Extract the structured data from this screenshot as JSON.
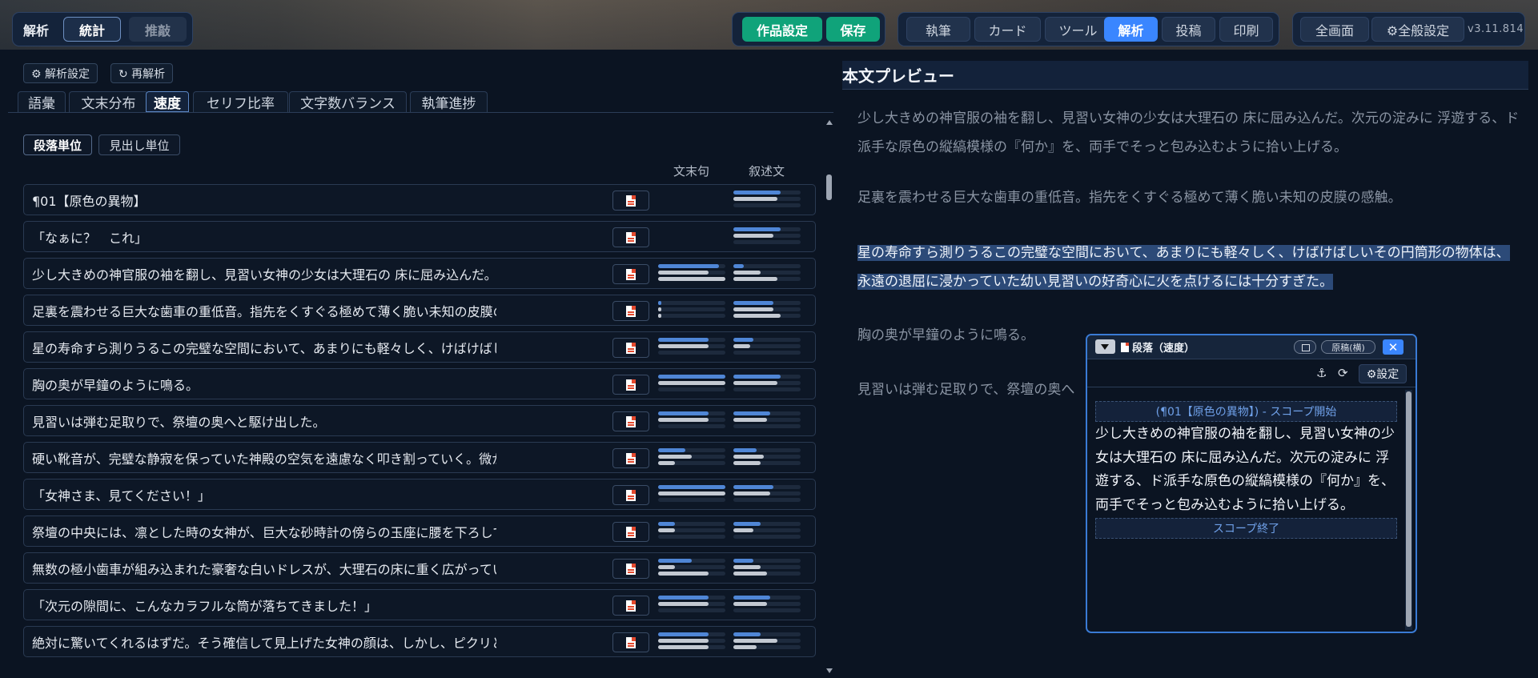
{
  "toolbar": {
    "left_group": {
      "label": "解析",
      "tab_stats": "統計",
      "tab_revise": "推敲"
    },
    "work_settings": "作品設定",
    "save": "保存",
    "mode_tabs": [
      "執筆",
      "カード",
      "ツール",
      "解析",
      "投稿",
      "印刷"
    ],
    "active_mode": "解析",
    "fullscreen": "全画面",
    "global_settings": "⚙全般設定",
    "version": "v3.11.814"
  },
  "analysis": {
    "settings_button": "⚙ 解析設定",
    "reanalyze_button": "↻ 再解析",
    "tabs": [
      "語彙",
      "文末分布",
      "速度",
      "セリフ比率",
      "文字数バランス",
      "執筆進捗"
    ],
    "active_tab": "速度",
    "unit_paragraph": "段落単位",
    "unit_heading": "見出し単位",
    "col_sentence_end": "文末句",
    "col_narrative": "叙述文",
    "rows": [
      {
        "text": "¶01【原色の異物】",
        "a": [],
        "b": [
          0.7,
          0.65,
          0
        ]
      },
      {
        "text": "「なぁに？　これ」",
        "a": [],
        "b": [
          0.7,
          0.6,
          0
        ]
      },
      {
        "text": "少し大きめの神官服の袖を翻し、見習い女神の少女は大理石の 床に屈み込んだ。次元の淀み…",
        "a": [
          0.9,
          0.75,
          1.0
        ],
        "b": [
          0.15,
          0.4,
          0.65
        ]
      },
      {
        "text": "足裏を震わせる巨大な歯車の重低音。指先をくすぐる極めて薄く脆い未知の皮膜の感触。",
        "a": [
          0.05,
          0.05,
          0.05
        ],
        "b": [
          0.6,
          0.6,
          0.7
        ]
      },
      {
        "text": "星の寿命すら測りうるこの完璧な空間において、あまりにも軽々しく、けばけばしいその円…",
        "a": [
          0.75,
          0.75,
          0
        ],
        "b": [
          0.3,
          0.25,
          0
        ]
      },
      {
        "text": "胸の奥が早鐘のように鳴る。",
        "a": [
          1.0,
          1.0,
          0
        ],
        "b": [
          0.7,
          0.65,
          0
        ]
      },
      {
        "text": "見習いは弾む足取りで、祭壇の奥へと駆け出した。",
        "a": [
          0.75,
          0.75,
          0
        ],
        "b": [
          0.55,
          0.5,
          0
        ]
      },
      {
        "text": "硬い靴音が、完璧な静寂を保っていた神殿の空気を遠慮なく叩き割っていく。微かな罪悪感…",
        "a": [
          0.4,
          0.5,
          0.25
        ],
        "b": [
          0.35,
          0.45,
          0.4
        ]
      },
      {
        "text": "「女神さま、見てください！」",
        "a": [
          1.0,
          1.0,
          0
        ],
        "b": [
          0.6,
          0.55,
          0
        ]
      },
      {
        "text": "祭壇の中央には、凛とした時の女神が、巨大な砂時計の傍らの玉座に腰を下ろしていた。",
        "a": [
          0.25,
          0.25,
          0
        ],
        "b": [
          0.4,
          0.3,
          0
        ]
      },
      {
        "text": "無数の極小歯車が組み込まれた豪奢な白いドレスが、大理石の床に重く広がっている。見習…",
        "a": [
          0.5,
          0.25,
          0.75
        ],
        "b": [
          0.3,
          0.4,
          0.5
        ]
      },
      {
        "text": "「次元の隙間に、こんなカラフルな筒が落ちてきました！」",
        "a": [
          0.75,
          0.75,
          0
        ],
        "b": [
          0.55,
          0.5,
          0
        ]
      },
      {
        "text": "絶対に驚いてくれるはずだ。そう確信して見上げた女神の顔は、しかし、ピクリとも動かな…",
        "a": [
          0.75,
          0.75,
          0.75
        ],
        "b": [
          0.4,
          0.65,
          0.35
        ]
      }
    ]
  },
  "preview": {
    "title": "本文プレビュー",
    "paragraphs": [
      "少し大きめの神官服の袖を翻し、見習い女神の少女は大理石の 床に屈み込んだ。次元の淀みに 浮遊する、ド派手な原色の縦縞模様の『何か』を、両手でそっと包み込むように拾い上げる。",
      "足裏を震わせる巨大な歯車の重低音。指先をくすぐる極めて薄く脆い未知の皮膜の感触。",
      "星の寿命すら測りうるこの完璧な空間において、あまりにも軽々しく、けばけばしいその円筒形の物体は、永遠の退屈に浸かっていた幼い見習いの好奇心に火を点けるには十分すぎた。",
      "胸の奥が早鐘のように鳴る。",
      "見習いは弾む足取りで、祭壇の奥へ"
    ]
  },
  "popup": {
    "title": "段落（速度）",
    "mode": "原稿(横)",
    "close": "✕",
    "anchor_icon": "⚓",
    "refresh_icon": "⟳",
    "settings": "⚙設定",
    "scope_start": "(¶01【原色の異物】) - スコープ開始",
    "body": "少し大きめの神官服の袖を翻し、見習い女神の少女は大理石の 床に屈み込んだ。次元の淀みに 浮遊する、ド派手な原色の縦縞模様の『何か』を、両手でそっと包み込むように拾い上げる。",
    "scope_end": "スコープ終了"
  }
}
